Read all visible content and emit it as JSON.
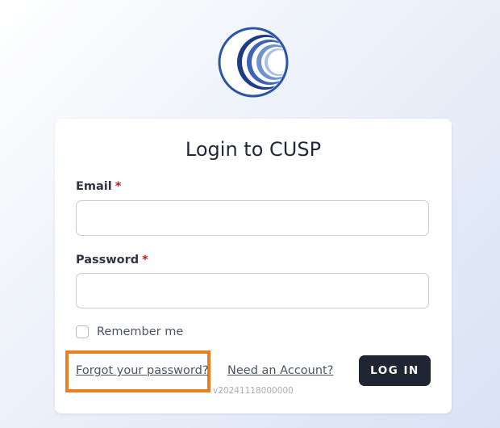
{
  "login": {
    "title": "Login to CUSP",
    "email_label": "Email",
    "password_label": "Password",
    "required_marker": "*",
    "email_value": "",
    "password_value": "",
    "remember_label": "Remember me",
    "remember_checked": false,
    "forgot_link": "Forgot your password?",
    "need_account_link": "Need an Account?",
    "login_button": "LOG IN",
    "version": "v20241118000000"
  },
  "icons": {
    "logo": "cusp-logo-icon"
  },
  "colors": {
    "primary_button": "#1f2633",
    "logo_blue": "#2b55a6",
    "required": "#b91c1c",
    "highlight": "#ee7d22"
  }
}
